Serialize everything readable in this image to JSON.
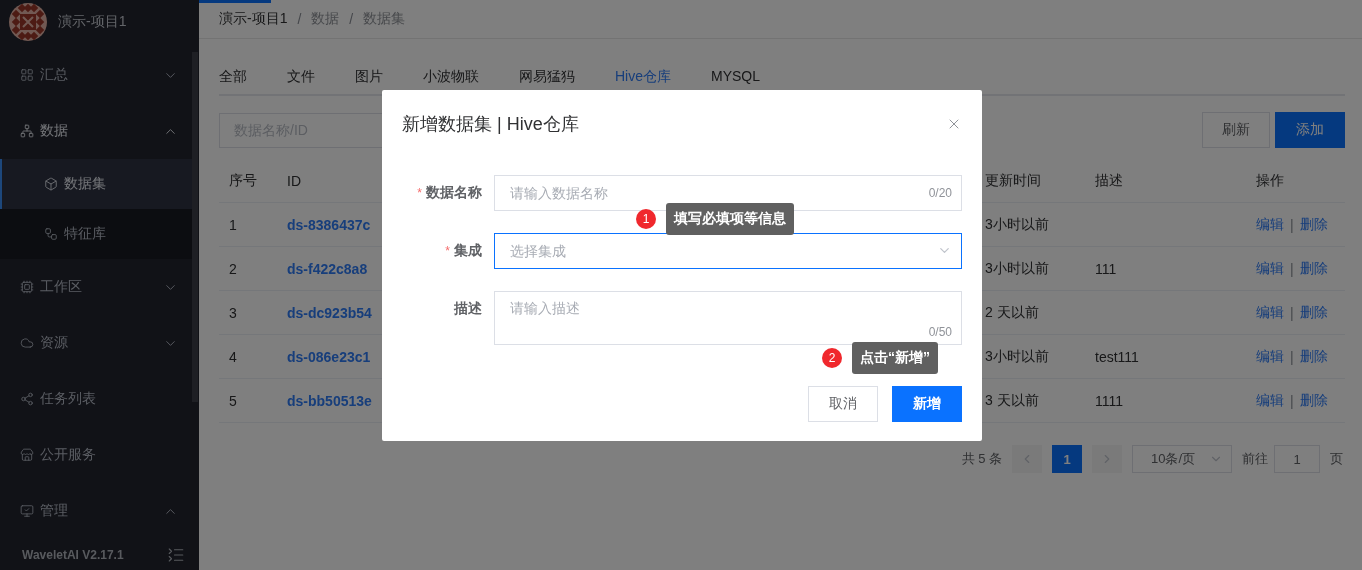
{
  "sidebar": {
    "project": "演示-项目1",
    "items": [
      {
        "label": "汇总",
        "selected": false,
        "expanded": false
      },
      {
        "label": "数据",
        "selected": true,
        "expanded": true,
        "children": [
          {
            "label": "数据集",
            "selected": true
          },
          {
            "label": "特征库",
            "selected": false
          }
        ]
      },
      {
        "label": "工作区",
        "selected": false,
        "expanded": false
      },
      {
        "label": "资源",
        "selected": false,
        "expanded": false
      },
      {
        "label": "任务列表",
        "selected": false
      },
      {
        "label": "公开服务",
        "selected": false
      },
      {
        "label": "管理",
        "selected": false,
        "expanded": true
      }
    ],
    "version": "WaveletAI V2.17.1"
  },
  "breadcrumb": {
    "items": [
      "演示-项目1",
      "数据",
      "数据集"
    ],
    "separator": "/"
  },
  "tabs": [
    {
      "label": "全部",
      "selected": false
    },
    {
      "label": "文件",
      "selected": false
    },
    {
      "label": "图片",
      "selected": false
    },
    {
      "label": "小波物联",
      "selected": false
    },
    {
      "label": "网易猛犸",
      "selected": false
    },
    {
      "label": "Hive仓库",
      "selected": true
    },
    {
      "label": "MYSQL",
      "selected": false
    }
  ],
  "search": {
    "placeholder": "数据名称/ID"
  },
  "toolbar_buttons": {
    "refresh": "刷新",
    "add": "添加"
  },
  "table": {
    "action_separator": "|",
    "columns": [
      "序号",
      "ID",
      "更新时间",
      "描述",
      "操作"
    ],
    "rows": [
      {
        "index": "1",
        "id": "ds-8386437c",
        "updated": "3小时以前",
        "actions": [
          "编辑",
          "删除"
        ]
      },
      {
        "index": "2",
        "id": "ds-f422c8a8",
        "updated": "3小时以前",
        "description": "111",
        "actions": [
          "编辑",
          "删除"
        ]
      },
      {
        "index": "3",
        "id": "ds-dc923b54",
        "updated": "2 天以前",
        "actions": [
          "编辑",
          "删除"
        ]
      },
      {
        "index": "4",
        "id": "ds-086e23c1",
        "updated": "3小时以前",
        "description": "test111",
        "actions": [
          "编辑",
          "删除"
        ]
      },
      {
        "index": "5",
        "id": "ds-bb50513e",
        "updated": "3 天以前",
        "description": "1111",
        "actions": [
          "编辑",
          "删除"
        ]
      }
    ]
  },
  "pagination": {
    "total": "共 5 条",
    "prev_disabled": true,
    "next_disabled": true,
    "pages": [
      {
        "label": "1",
        "selected": true
      }
    ],
    "page_size": "10条/页",
    "goto_label": "前往",
    "goto_value": "1",
    "goto_suffix": "页"
  },
  "dialog": {
    "title": "新增数据集 | Hive仓库",
    "fields": [
      {
        "kind": "input",
        "marker": "*",
        "label": "数据名称",
        "placeholder": "请输入数据名称",
        "counter": "0/20",
        "focused": false
      },
      {
        "kind": "select",
        "marker": "*",
        "label": "集成",
        "placeholder": "选择集成",
        "focused": true
      },
      {
        "kind": "textarea",
        "label": "描述",
        "placeholder": "请输入描述",
        "counter": "0/50",
        "focused": false
      }
    ],
    "cancel": "取消",
    "confirm": "新增"
  },
  "guides": [
    {
      "number": "1",
      "text": "填写必填项等信息"
    },
    {
      "number": "2",
      "text": "点击“新增”"
    }
  ]
}
